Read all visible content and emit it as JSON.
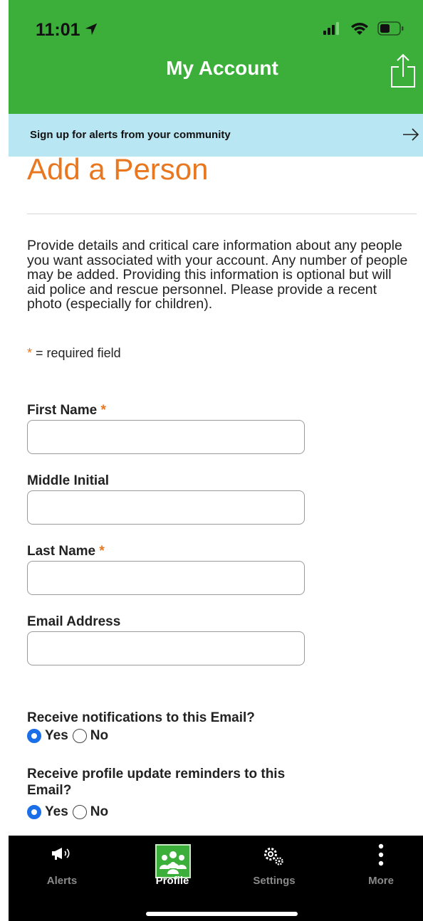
{
  "status_bar": {
    "time": "11:01"
  },
  "nav": {
    "title": "My Account"
  },
  "banner": {
    "text": "Sign up for alerts from your community"
  },
  "form": {
    "heading": "Add a Person",
    "intro": "Provide details and critical care information about any people you want associated with your account. Any number of people may be added. Providing this information is optional but will aid police and rescue personnel. Please provide a recent photo (especially for children).",
    "required_star": "*",
    "required_note": " = required field",
    "fields": [
      {
        "label": "First Name",
        "required": "*",
        "value": ""
      },
      {
        "label": "Middle Initial",
        "required": "",
        "value": ""
      },
      {
        "label": "Last Name",
        "required": "*",
        "value": ""
      },
      {
        "label": "Email Address",
        "required": "",
        "value": ""
      }
    ],
    "questions": [
      {
        "text": "Receive notifications to this Email?",
        "yes": "Yes",
        "no": "No",
        "selected": "Yes"
      },
      {
        "text": "Receive profile update reminders to this Email?",
        "yes": "Yes",
        "no": "No",
        "selected": "Yes"
      }
    ]
  },
  "tabbar": {
    "tabs": [
      {
        "label": "Alerts",
        "icon": "megaphone-icon"
      },
      {
        "label": "Profile",
        "icon": "people-icon",
        "active": true
      },
      {
        "label": "Settings",
        "icon": "gears-icon"
      },
      {
        "label": "More",
        "icon": "more-vertical-icon"
      }
    ]
  },
  "colors": {
    "header_green": "#3cae3a",
    "banner_blue": "#b8e6f3",
    "heading_orange": "#e8771f",
    "radio_blue": "#1a6fe8"
  }
}
